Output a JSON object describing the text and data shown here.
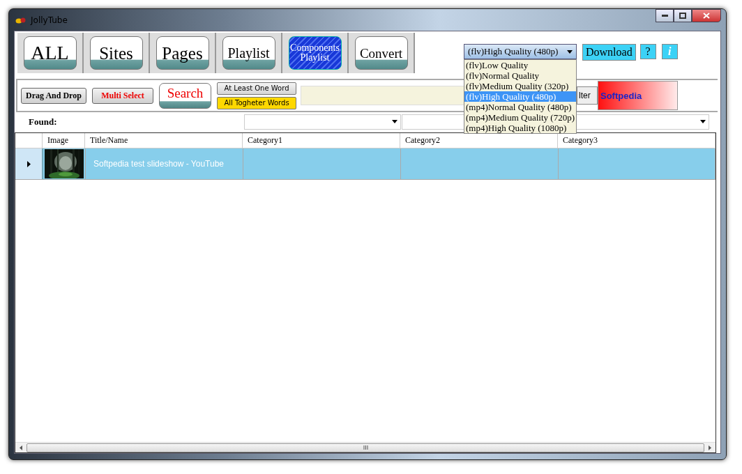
{
  "window": {
    "title": "JollyTube"
  },
  "tabs": [
    {
      "label": "ALL",
      "selected": false
    },
    {
      "label": "Sites",
      "selected": false
    },
    {
      "label": "Pages",
      "selected": false
    },
    {
      "label": "Playlist",
      "selected": false
    },
    {
      "label": "Components Playlist",
      "selected": true
    },
    {
      "label": "Convert",
      "selected": false
    }
  ],
  "quality": {
    "value": "(flv)High Quality (480p)",
    "expanded": true,
    "options": [
      {
        "label": "(flv)Low Quality",
        "selected": false
      },
      {
        "label": "(flv)Normal Quality",
        "selected": false
      },
      {
        "label": "(flv)Medium Quality (320p)",
        "selected": false
      },
      {
        "label": "(flv)High Quality (480p)",
        "selected": true
      },
      {
        "label": "(mp4)Normal Quality (480p)",
        "selected": false
      },
      {
        "label": "(mp4)Medium Quality (720p)",
        "selected": false
      },
      {
        "label": "(mp4)High Quality (1080p)",
        "selected": false
      }
    ]
  },
  "top_buttons": {
    "download": "Download",
    "help": "?",
    "info": "i"
  },
  "toolbar": {
    "drag_drop": "Drag And Drop",
    "multi_select": "Multi Select",
    "search": "Search",
    "match_modes": [
      {
        "label": "At Least One Word",
        "selected": false
      },
      {
        "label": "All Togheter Words",
        "selected": true
      }
    ],
    "filter_button": "lter",
    "banner": "Softpedia"
  },
  "found_label": "Found:",
  "table": {
    "columns": [
      "Image",
      "Title/Name",
      "Category1",
      "Category2",
      "Category3"
    ],
    "rows": [
      {
        "title": "Softpedia test slideshow - YouTube",
        "selected": true
      }
    ]
  }
}
